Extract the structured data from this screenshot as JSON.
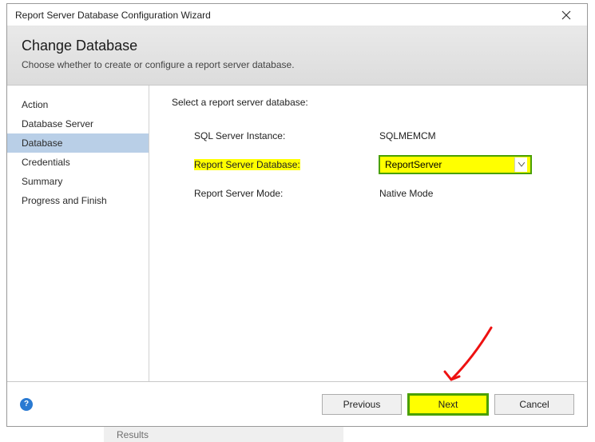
{
  "window": {
    "title": "Report Server Database Configuration Wizard"
  },
  "header": {
    "title": "Change Database",
    "subtitle": "Choose whether to create or configure a report server database."
  },
  "sidebar": {
    "items": [
      {
        "label": "Action"
      },
      {
        "label": "Database Server"
      },
      {
        "label": "Database"
      },
      {
        "label": "Credentials"
      },
      {
        "label": "Summary"
      },
      {
        "label": "Progress and Finish"
      }
    ],
    "active_index": 2
  },
  "content": {
    "heading": "Select a report server database:",
    "rows": {
      "instance": {
        "label": "SQL Server Instance:",
        "value": "SQLMEMCM"
      },
      "database": {
        "label": "Report Server Database:",
        "value": "ReportServer"
      },
      "mode": {
        "label": "Report Server Mode:",
        "value": "Native Mode"
      }
    }
  },
  "footer": {
    "previous": "Previous",
    "next": "Next",
    "cancel": "Cancel"
  },
  "help_icon_glyph": "?",
  "under_strip": "Results"
}
